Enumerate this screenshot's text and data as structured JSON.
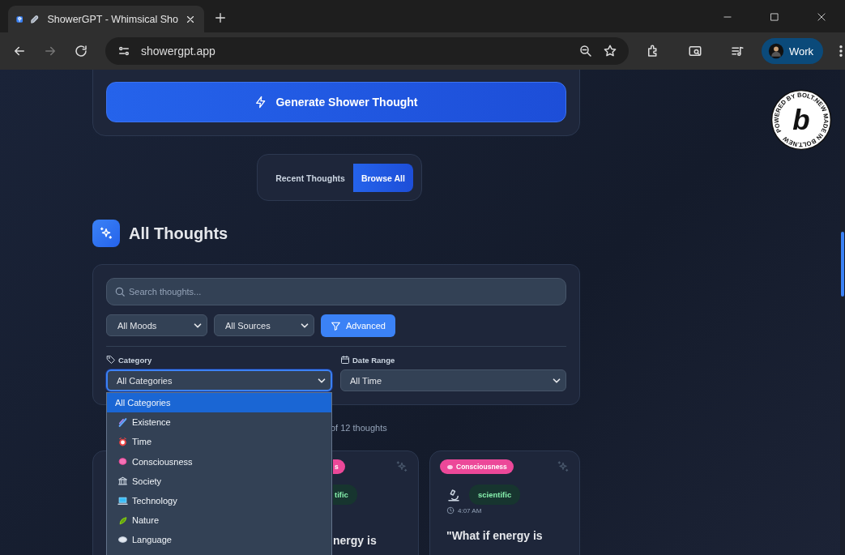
{
  "browser": {
    "tab_title": "ShowerGPT - Whimsical Sho",
    "address": "showergpt.app",
    "profile": "Work"
  },
  "generate_button": "Generate Shower Thought",
  "view_tabs": [
    {
      "label": "Recent Thoughts",
      "selected": false
    },
    {
      "label": "Browse All",
      "selected": true
    }
  ],
  "section_title": "All Thoughts",
  "filters": {
    "search": {
      "placeholder": "Search thoughts..."
    },
    "selects": [
      "All Moods",
      "All Sources"
    ],
    "advanced_button": "Advanced",
    "category_label": "Category",
    "category_value": "All Categories",
    "date_label": "Date Range",
    "date_value": "All Time"
  },
  "category_options": [
    {
      "label": "All Categories",
      "selected": true
    },
    {
      "label": "Existence",
      "selected": false
    },
    {
      "label": "Time",
      "selected": false
    },
    {
      "label": "Consciousness",
      "selected": false
    },
    {
      "label": "Society",
      "selected": false
    },
    {
      "label": "Technology",
      "selected": false
    },
    {
      "label": "Nature",
      "selected": false
    },
    {
      "label": "Language",
      "selected": false
    }
  ],
  "results_count": "of 12 thoughts",
  "cards": [
    {
      "kind": "hidden"
    },
    {
      "kind": "partial",
      "category": "s",
      "mood": "tific",
      "quote": "nergy is"
    },
    {
      "kind": "full",
      "category": "Consciousness",
      "mood": "scientific",
      "time": "4:07 AM",
      "quote": "\"What if energy is"
    }
  ],
  "badge": {
    "text": "POWERED BY BOLT.NEW MADE IN BOLT.NEW",
    "letter": "b"
  }
}
